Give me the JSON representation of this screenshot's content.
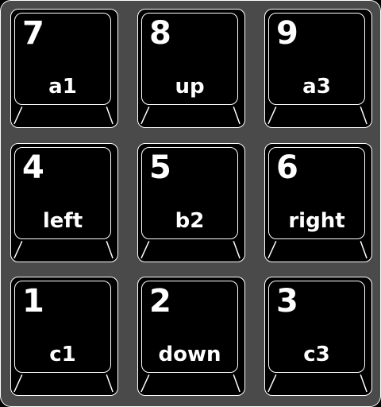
{
  "keypad": {
    "background_color": "#4a4a4a",
    "key_color": "#000000",
    "outline_color": "#ffffff",
    "keys": [
      {
        "number": "7",
        "label": "a1"
      },
      {
        "number": "8",
        "label": "up"
      },
      {
        "number": "9",
        "label": "a3"
      },
      {
        "number": "4",
        "label": "left"
      },
      {
        "number": "5",
        "label": "b2"
      },
      {
        "number": "6",
        "label": "right"
      },
      {
        "number": "1",
        "label": "c1"
      },
      {
        "number": "2",
        "label": "down"
      },
      {
        "number": "3",
        "label": "c3"
      }
    ]
  }
}
